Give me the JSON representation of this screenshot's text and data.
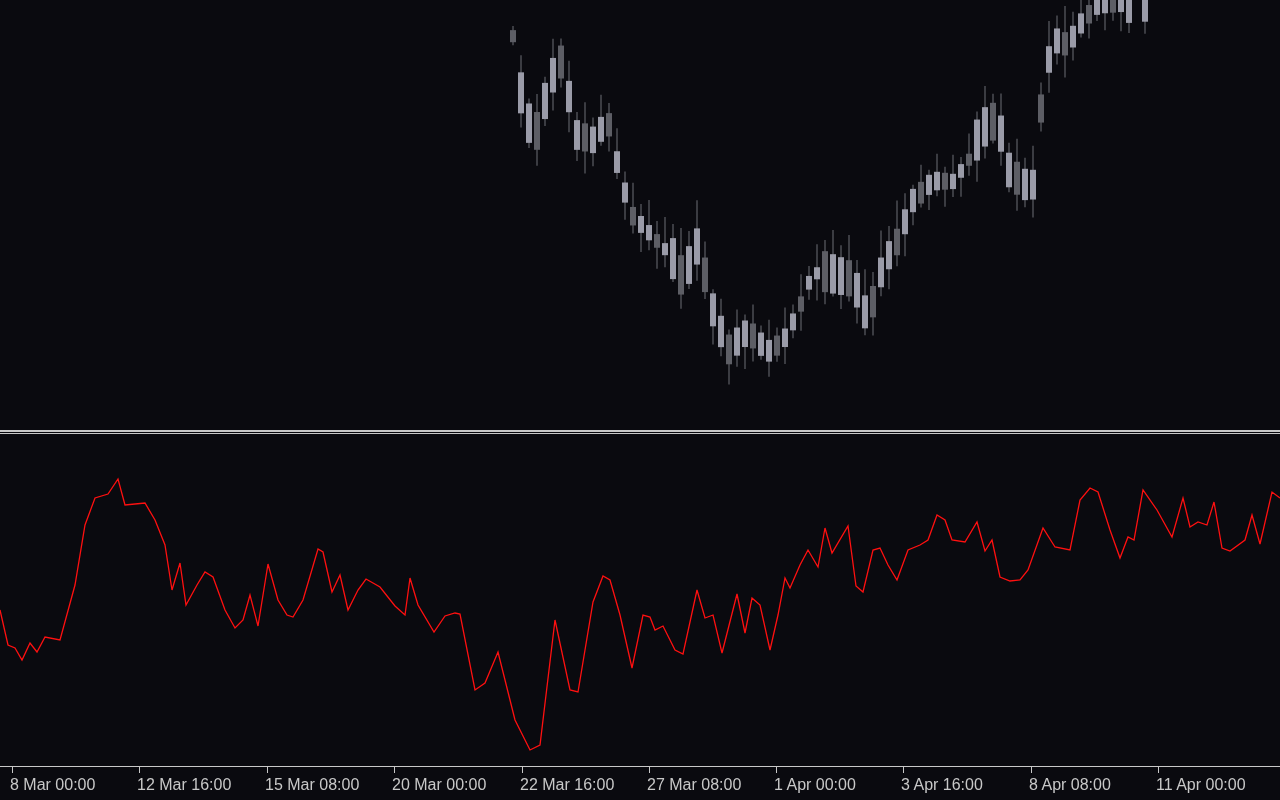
{
  "time_axis": {
    "labels": [
      "8 Mar 00:00",
      "12 Mar 16:00",
      "15 Mar 08:00",
      "20 Mar 00:00",
      "22 Mar 16:00",
      "27 Mar 08:00",
      "1 Apr 00:00",
      "3 Apr 16:00",
      "8 Apr 08:00",
      "11 Apr 00:00"
    ]
  }
}
